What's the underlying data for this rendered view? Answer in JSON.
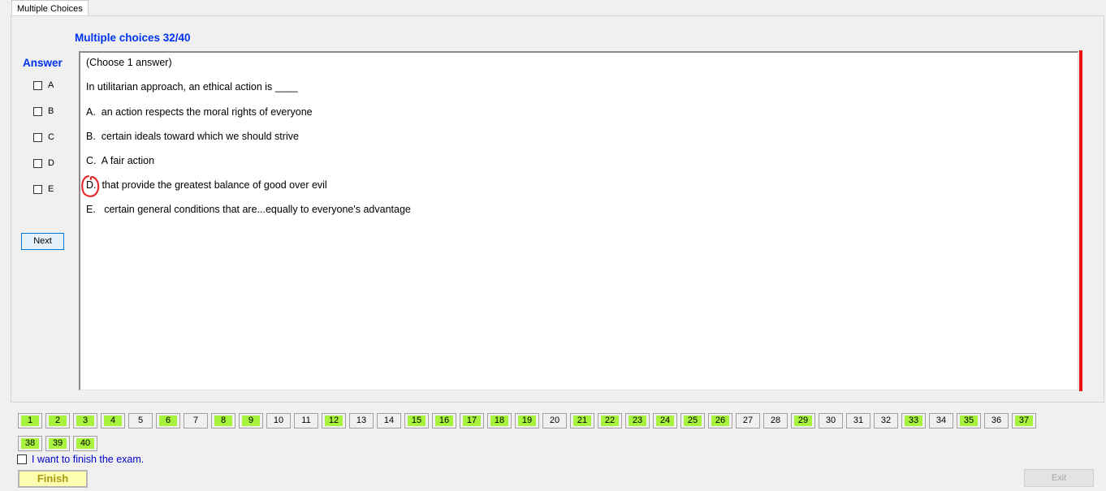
{
  "tab": {
    "label": "Multiple Choices"
  },
  "question_header": "Multiple choices 32/40",
  "answer_panel": {
    "title": "Answer",
    "options": [
      "A",
      "B",
      "C",
      "D",
      "E"
    ],
    "next_label": "Next"
  },
  "question": {
    "instruction": "(Choose 1 answer)",
    "stem": "In utilitarian approach, an ethical action is ____",
    "choices": [
      "A.  an action respects the moral rights of everyone",
      "B.  certain ideals toward which we should strive",
      "C.  A fair action",
      "D.  that provide the greatest balance of good over evil",
      "E.   certain general conditions that are...equally to everyone's advantage"
    ]
  },
  "navigation": {
    "questions": [
      {
        "label": "1",
        "answered": true
      },
      {
        "label": "2",
        "answered": true
      },
      {
        "label": "3",
        "answered": true
      },
      {
        "label": "4",
        "answered": true
      },
      {
        "label": "5",
        "answered": false
      },
      {
        "label": "6",
        "answered": true
      },
      {
        "label": "7",
        "answered": false
      },
      {
        "label": "8",
        "answered": true
      },
      {
        "label": "9",
        "answered": true
      },
      {
        "label": "10",
        "answered": false
      },
      {
        "label": "11",
        "answered": false
      },
      {
        "label": "12",
        "answered": true
      },
      {
        "label": "13",
        "answered": false
      },
      {
        "label": "14",
        "answered": false
      },
      {
        "label": "15",
        "answered": true
      },
      {
        "label": "16",
        "answered": true
      },
      {
        "label": "17",
        "answered": true
      },
      {
        "label": "18",
        "answered": true
      },
      {
        "label": "19",
        "answered": true
      },
      {
        "label": "20",
        "answered": false
      },
      {
        "label": "21",
        "answered": true
      },
      {
        "label": "22",
        "answered": true
      },
      {
        "label": "23",
        "answered": true
      },
      {
        "label": "24",
        "answered": true
      },
      {
        "label": "25",
        "answered": true
      },
      {
        "label": "26",
        "answered": true
      },
      {
        "label": "27",
        "answered": false
      },
      {
        "label": "28",
        "answered": false
      },
      {
        "label": "29",
        "answered": true
      },
      {
        "label": "30",
        "answered": false
      },
      {
        "label": "31",
        "answered": false
      },
      {
        "label": "32",
        "answered": false
      },
      {
        "label": "33",
        "answered": true
      },
      {
        "label": "34",
        "answered": false
      },
      {
        "label": "35",
        "answered": true
      },
      {
        "label": "36",
        "answered": false
      },
      {
        "label": "37",
        "answered": true
      },
      {
        "label": "38",
        "answered": true
      },
      {
        "label": "39",
        "answered": true
      },
      {
        "label": "40",
        "answered": true
      }
    ]
  },
  "footer": {
    "finish_check_label": "I want to finish the exam.",
    "finish_label": "Finish",
    "exit_label": "Exit"
  },
  "colors": {
    "title_blue": "#0033ee",
    "answered_green": "#a6f23c",
    "marker_red": "#ee1111",
    "finish_yellow": "#ffffb2"
  }
}
